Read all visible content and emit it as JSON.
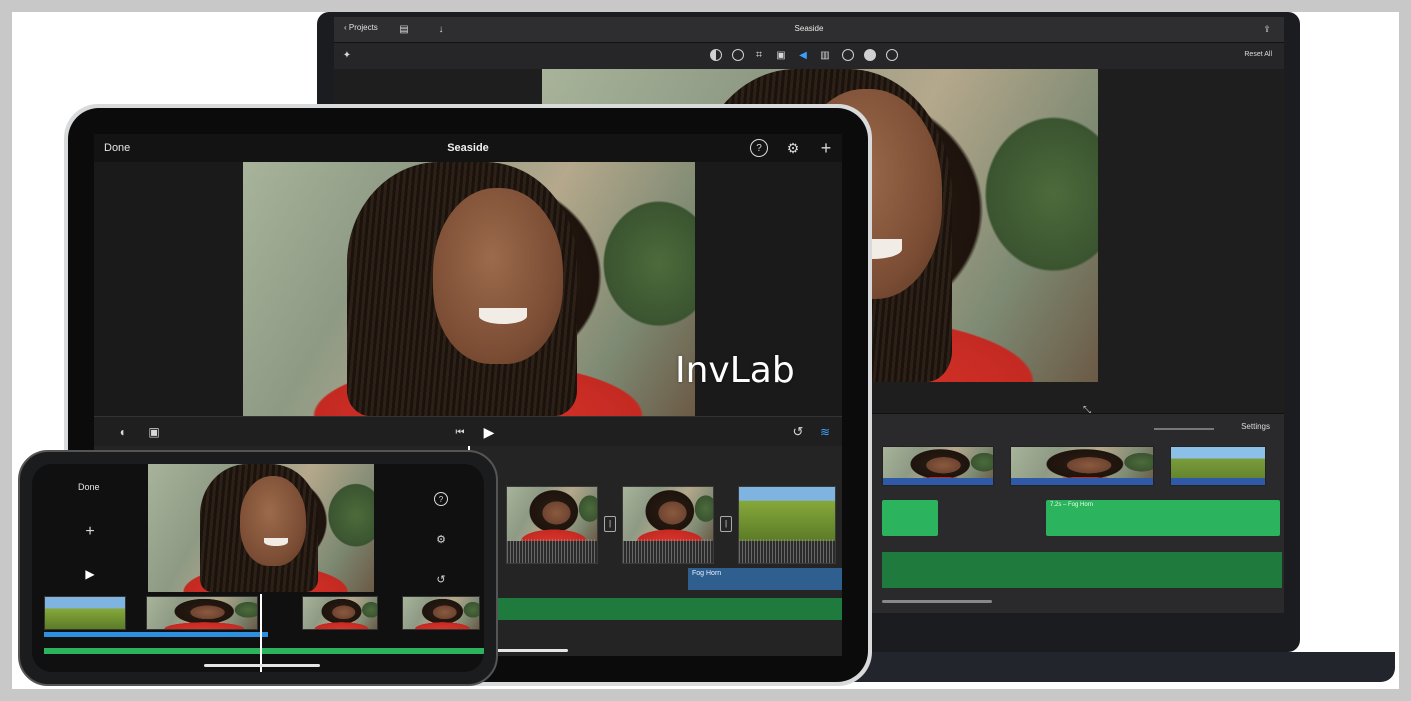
{
  "mac": {
    "back_label": "Projects",
    "title": "Seaside",
    "reset_label": "Reset All",
    "settings_label": "Settings",
    "audio_clip_label": "7.2s – Fog Horn"
  },
  "ipad": {
    "done_label": "Done",
    "title": "Seaside",
    "fog_label": "Fog Horn"
  },
  "iphone": {
    "done_label": "Done"
  },
  "watermark": "InvLab",
  "colors": {
    "accent_blue": "#2d8fe0",
    "audio_green": "#2bb35d",
    "mac_body": "#1b1c1f",
    "ipad_frame": "#d9dadc"
  },
  "icons": [
    "chevron-left-icon",
    "film-icon",
    "download-icon",
    "magic-wand-icon",
    "color-balance-icon",
    "palette-icon",
    "crop-icon",
    "stabilize-icon",
    "volume-icon",
    "equalizer-icon",
    "speed-icon",
    "noise-icon",
    "info-icon",
    "share-icon",
    "expand-icon",
    "help-icon",
    "settings-icon",
    "plus-icon",
    "play-icon",
    "skip-back-icon",
    "undo-icon",
    "mic-icon",
    "camera-icon",
    "waveform-icon"
  ]
}
